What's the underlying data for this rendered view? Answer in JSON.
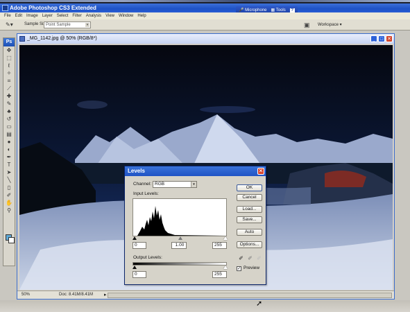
{
  "app": {
    "title": "Adobe Photoshop CS3 Extended"
  },
  "badge": {
    "microphone": "Microphone",
    "tools": "Tools",
    "help": "?"
  },
  "menubar": [
    "File",
    "Edit",
    "Image",
    "Layer",
    "Select",
    "Filter",
    "Analysis",
    "View",
    "Window",
    "Help"
  ],
  "options": {
    "sample_label": "Sample Size:",
    "sample_value": "Point Sample",
    "workspace": "Workspace ▾"
  },
  "toolbox": {
    "logo": "Ps",
    "tools": [
      "move",
      "marquee",
      "lasso",
      "quick-select",
      "crop",
      "slice",
      "healing",
      "brush",
      "stamp",
      "history-brush",
      "eraser",
      "gradient",
      "blur",
      "dodge",
      "pen",
      "type",
      "path-select",
      "shape",
      "notes",
      "eyedropper",
      "hand",
      "zoom"
    ]
  },
  "document": {
    "title": "_MG_1142.jpg @ 50% (RGB/8*)",
    "zoom": "50%",
    "doc_info": "Doc: 8.41M/8.41M"
  },
  "levels": {
    "title": "Levels",
    "channel_label": "Channel:",
    "channel_value": "RGB",
    "input_label": "Input Levels:",
    "input_black": "0",
    "input_gamma": "1.00",
    "input_white": "255",
    "output_label": "Output Levels:",
    "output_black": "0",
    "output_white": "255",
    "buttons": {
      "ok": "OK",
      "cancel": "Cancel",
      "load": "Load...",
      "save": "Save...",
      "auto": "Auto",
      "options": "Options..."
    },
    "preview_label": "Preview",
    "preview_checked": true
  },
  "colors": {
    "xp_blue": "#2053c5",
    "close_red": "#d2442a",
    "foreground": "#5fa9d6",
    "background": "#ffffff"
  }
}
